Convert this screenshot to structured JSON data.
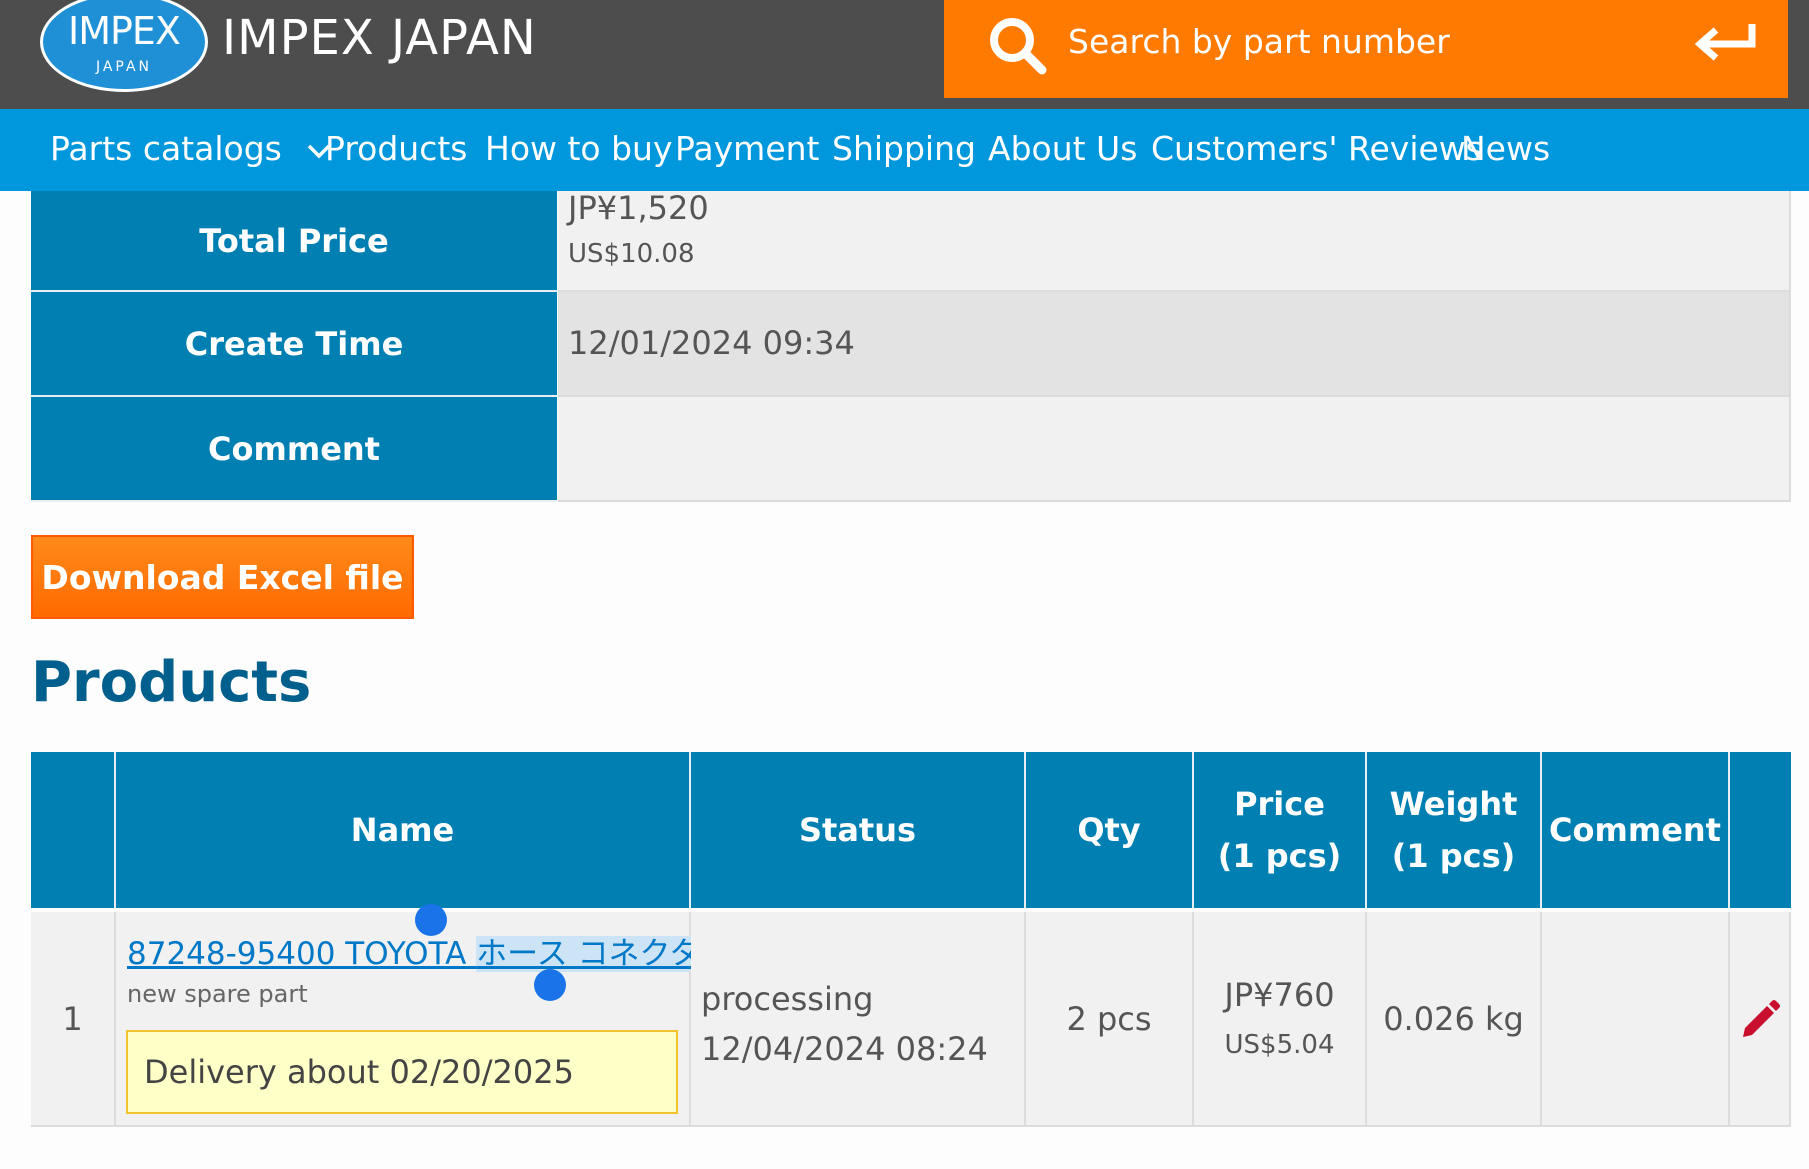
{
  "header": {
    "logo_main": "IMPEX",
    "logo_sub": "JAPAN",
    "brand": "IMPEX JAPAN",
    "search_placeholder": "Search by part number"
  },
  "nav": {
    "items": [
      "Parts catalogs",
      "Products",
      "How to buy",
      "Payment",
      "Shipping",
      "About Us",
      "Customers' Reviews",
      "News"
    ]
  },
  "order_info": {
    "total_price_label": "Total Price",
    "total_price_jpy": "JP¥1,520",
    "total_price_usd": "US$10.08",
    "create_time_label": "Create Time",
    "create_time_value": "12/01/2024 09:34",
    "comment_label": "Comment",
    "comment_value": ""
  },
  "download_button": "Download Excel file",
  "products_title": "Products",
  "products_table": {
    "headers": {
      "name": "Name",
      "status": "Status",
      "qty": "Qty",
      "price_l1": "Price",
      "price_l2": "(1 pcs)",
      "weight_l1": "Weight",
      "weight_l2": "(1 pcs)",
      "comment": "Comment"
    },
    "rows": [
      {
        "index": "1",
        "link_main": "87248-95400 TOYOTA ",
        "link_selected": "ホース コネクタ",
        "subtitle": "new spare part",
        "delivery": "Delivery about 02/20/2025",
        "status": "processing",
        "status_time": "12/04/2024 08:24",
        "qty": "2 pcs",
        "price_jpy": "JP¥760",
        "price_usd": "US$5.04",
        "weight": "0.026 kg",
        "comment": ""
      }
    ]
  },
  "colors": {
    "topbar": "#4d4d4d",
    "search_bg": "#ff7a00",
    "nav_bg": "#0097dc",
    "table_header": "#0080b2",
    "title": "#005f8c",
    "edit_icon": "#c8102e"
  },
  "icons": {
    "search": "search-icon",
    "enter": "enter-icon",
    "chevron": "chevron-down-icon",
    "edit": "pencil-icon"
  }
}
